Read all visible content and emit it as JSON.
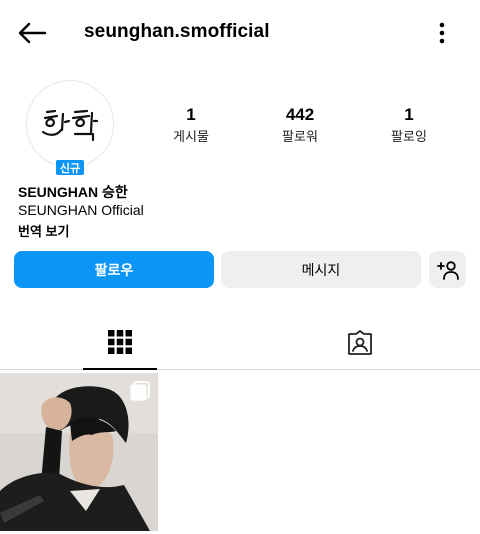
{
  "header": {
    "username": "seunghan.smofficial",
    "back_icon": "arrow-left-icon",
    "more_icon": "more-vertical-icon"
  },
  "profile": {
    "avatar_icon": "handwritten-logo",
    "new_badge": "신규",
    "stats": {
      "posts": {
        "value": "1",
        "label": "게시물"
      },
      "followers": {
        "value": "442",
        "label": "팔로워"
      },
      "following": {
        "value": "1",
        "label": "팔로잉"
      }
    },
    "name": "SEUNGHAN 승한",
    "bio": "SEUNGHAN Official",
    "translate": "번역 보기"
  },
  "actions": {
    "follow_label": "팔로우",
    "message_label": "메시지",
    "add_user_icon": "person-add-icon"
  },
  "tabs": [
    {
      "icon": "grid-icon",
      "active": true
    },
    {
      "icon": "tagged-user-icon",
      "active": false
    }
  ],
  "posts": [
    {
      "type": "photo",
      "multi": true
    }
  ],
  "colors": {
    "primary": "#0b95f6",
    "secondary_button": "#efefef",
    "divider": "#dbdbdb"
  }
}
